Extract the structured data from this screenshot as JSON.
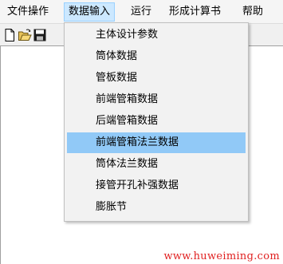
{
  "menubar": {
    "items": [
      {
        "label": "文件操作"
      },
      {
        "label": "数据输入"
      },
      {
        "label": "运行"
      },
      {
        "label": "形成计算书"
      },
      {
        "label": "帮助"
      }
    ]
  },
  "toolbar": {
    "buttons": [
      {
        "icon": "new-file-icon"
      },
      {
        "icon": "open-folder-icon"
      },
      {
        "icon": "save-icon"
      }
    ]
  },
  "dropdown": {
    "items": [
      {
        "label": "主体设计参数"
      },
      {
        "label": "筒体数据"
      },
      {
        "label": "管板数据"
      },
      {
        "label": "前端管箱数据"
      },
      {
        "label": "后端管箱数据"
      },
      {
        "label": "前端管箱法兰数据",
        "highlighted": true
      },
      {
        "label": "筒体法兰数据"
      },
      {
        "label": "接管开孔补强数据"
      },
      {
        "label": "膨胀节"
      }
    ]
  },
  "watermark": {
    "text": "www.huweiming.com"
  },
  "colors": {
    "menu_active_bg": "#cce8ff",
    "dropdown_highlight_bg": "#91c9f7",
    "watermark": "#e02020"
  }
}
